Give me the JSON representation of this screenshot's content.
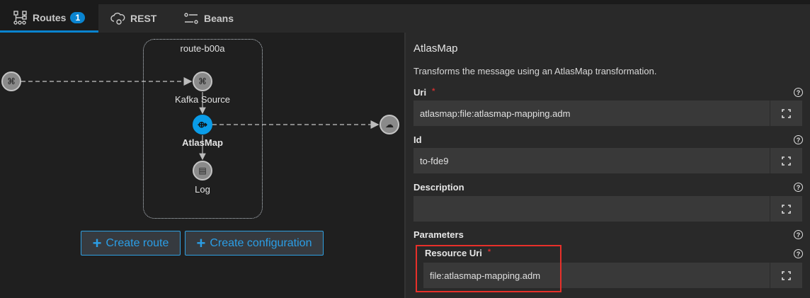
{
  "tabs": [
    {
      "label": "Routes",
      "badge": "1",
      "icon": "routes-icon",
      "active": true
    },
    {
      "label": "REST",
      "icon": "cloud-gear-icon"
    },
    {
      "label": "Beans",
      "icon": "sliders-icon"
    }
  ],
  "canvas": {
    "route_name": "route-b00a",
    "nodes": [
      {
        "label": "Kafka Source",
        "icon": "kafka-icon"
      },
      {
        "label": "AtlasMap",
        "icon": "atlasmap-icon",
        "selected": true
      },
      {
        "label": "Log",
        "icon": "log-icon"
      }
    ],
    "external_nodes": [
      {
        "icon": "kafka-icon"
      },
      {
        "icon": "cloud-stream-icon"
      }
    ],
    "buttons": {
      "create_route": "Create route",
      "create_configuration": "Create configuration",
      "plus": "+"
    }
  },
  "panel": {
    "title": "AtlasMap",
    "description": "Transforms the message using an AtlasMap transformation.",
    "required_mark": "*",
    "fields": [
      {
        "label": "Uri",
        "value": "atlasmap:file:atlasmap-mapping.adm",
        "required": true
      },
      {
        "label": "Id",
        "value": "to-fde9"
      },
      {
        "label": "Description",
        "value": ""
      }
    ],
    "parameters_label": "Parameters",
    "parameters": [
      {
        "label": "Resource Uri",
        "value": "file:atlasmap-mapping.adm",
        "required": true
      }
    ],
    "help": "?"
  },
  "colors": {
    "accent": "#0a84d0",
    "selected_node": "#0a9ce8",
    "highlight": "#e8302a"
  }
}
